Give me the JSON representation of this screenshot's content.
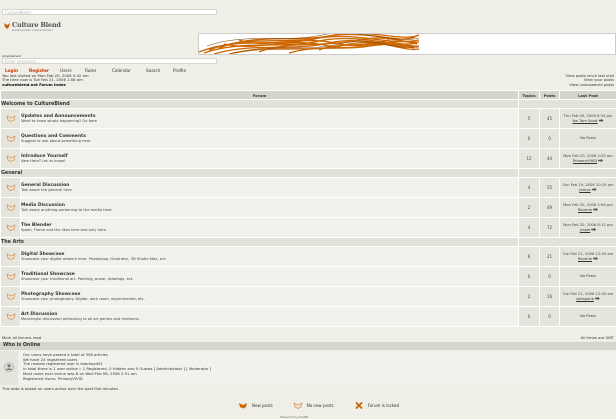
{
  "top_input": {
    "value": "CultureBlend"
  },
  "logo": {
    "name": "Culture Blend",
    "tagline": "breaking down cultural barriers"
  },
  "ad_text": "advertisement",
  "search": {
    "placeholder": "Enter keywords..."
  },
  "nav": {
    "login": "Login",
    "register": "Register",
    "users": "Users",
    "rules": "Rules",
    "calendar": "Calendar",
    "search": "Search",
    "profile": "Profile"
  },
  "info": {
    "last_visit": "You last visited on Mon Feb 20, 2006 5:42 am",
    "time_now": "The time now is Tue Feb 21, 2006 1:08 am",
    "index": "cultureblend.net Forum Index"
  },
  "right_links": {
    "since_last": "View posts since last visit",
    "your_posts": "View your posts",
    "unanswered": "View unanswered posts"
  },
  "table_headers": {
    "forum": "Forum",
    "topics": "Topics",
    "posts": "Posts",
    "last_post": "Last Post"
  },
  "categories": [
    {
      "name": "Welcome to CultureBlend",
      "forums": [
        {
          "name": "Updates and Announcements",
          "desc": "Want to know whats happening? Go here",
          "topics": "5",
          "posts": "45",
          "last_date": "Thu Feb 09, 2006 6:34 pm",
          "last_user": "Ibn Tom Scott"
        },
        {
          "name": "Questions and Comments",
          "desc": "Suggest or ask about something here",
          "topics": "0",
          "posts": "0",
          "last_date": "No Posts",
          "last_user": ""
        },
        {
          "name": "Introduce Yourself",
          "desc": "New Here? Let us know!",
          "topics": "12",
          "posts": "44",
          "last_date": "Mon Feb 20, 2006 2:29 am",
          "last_user": "PrimaryVIVID"
        }
      ]
    },
    {
      "name": "General",
      "forums": [
        {
          "name": "General Discussion",
          "desc": "Talk about the general here",
          "topics": "4",
          "posts": "55",
          "last_date": "Sun Feb 19, 2006 10:19 pm",
          "last_user": "Jamyo"
        },
        {
          "name": "Media Discussion",
          "desc": "Talk about anything pertaining to the media here",
          "topics": "2",
          "posts": "49",
          "last_date": "Mon Feb 20, 2006 4:56 pm",
          "last_user": "Reverie"
        },
        {
          "name": "The Blender",
          "desc": "Spam, Flame and the likes here and only here",
          "topics": "4",
          "posts": "72",
          "last_date": "Mon Feb 20, 2006 6:12 pm",
          "last_user": "jraple"
        }
      ]
    },
    {
      "name": "The Arts",
      "forums": [
        {
          "name": "Digital Showcase",
          "desc": "Showcase your digital artwork here. Photoshop, Illustrator, 3D Studio Max, ect.",
          "topics": "6",
          "posts": "21",
          "last_date": "Tue Feb 21, 2006 12:09 am",
          "last_user": "Reverie"
        },
        {
          "name": "Traditional Showcase",
          "desc": "Showcase your traditional art. Painting, prose, drawings, ect.",
          "topics": "0",
          "posts": "0",
          "last_date": "No Posts",
          "last_user": ""
        },
        {
          "name": "Photography Showcase",
          "desc": "Showcase your photography. Digital, dark room, experimental, etc.",
          "topics": "2",
          "posts": "16",
          "last_date": "Tue Feb 21, 2006 12:00 am",
          "last_user": "sallapene"
        },
        {
          "name": "Art Discussion",
          "desc": "Meaningful discussion pertaining to all art genres and mediums.",
          "topics": "0",
          "posts": "0",
          "last_date": "No Posts",
          "last_user": ""
        }
      ]
    }
  ],
  "footer_links": {
    "mark_read": "Mark all forums read",
    "times": "All times are GMT"
  },
  "who": {
    "title": "Who is Online",
    "line1": "Our users have posted a total of 306 articles",
    "line2": "We have 24 registered users",
    "line3": "The newest registered user is stephoyd01",
    "line4": "In total there is 1 user online :: 1 Registered, 0 Hidden and 0 Guests   [ Administrator ]   [ Moderator ]",
    "line5": "Most users ever online was 8 on Wed Feb 08, 2006 2:51 am",
    "line6": "Registered Users: PrimaryVIVID"
  },
  "note": "This data is based on users active over the past five minutes",
  "legend": {
    "new_posts": "New posts",
    "no_new_posts": "No new posts",
    "locked": "Forum is locked"
  },
  "powered": "Powered by phpBB",
  "colors": {
    "accent": "#cc6600",
    "bg": "#efeee7",
    "header": "#d6d5cc"
  }
}
